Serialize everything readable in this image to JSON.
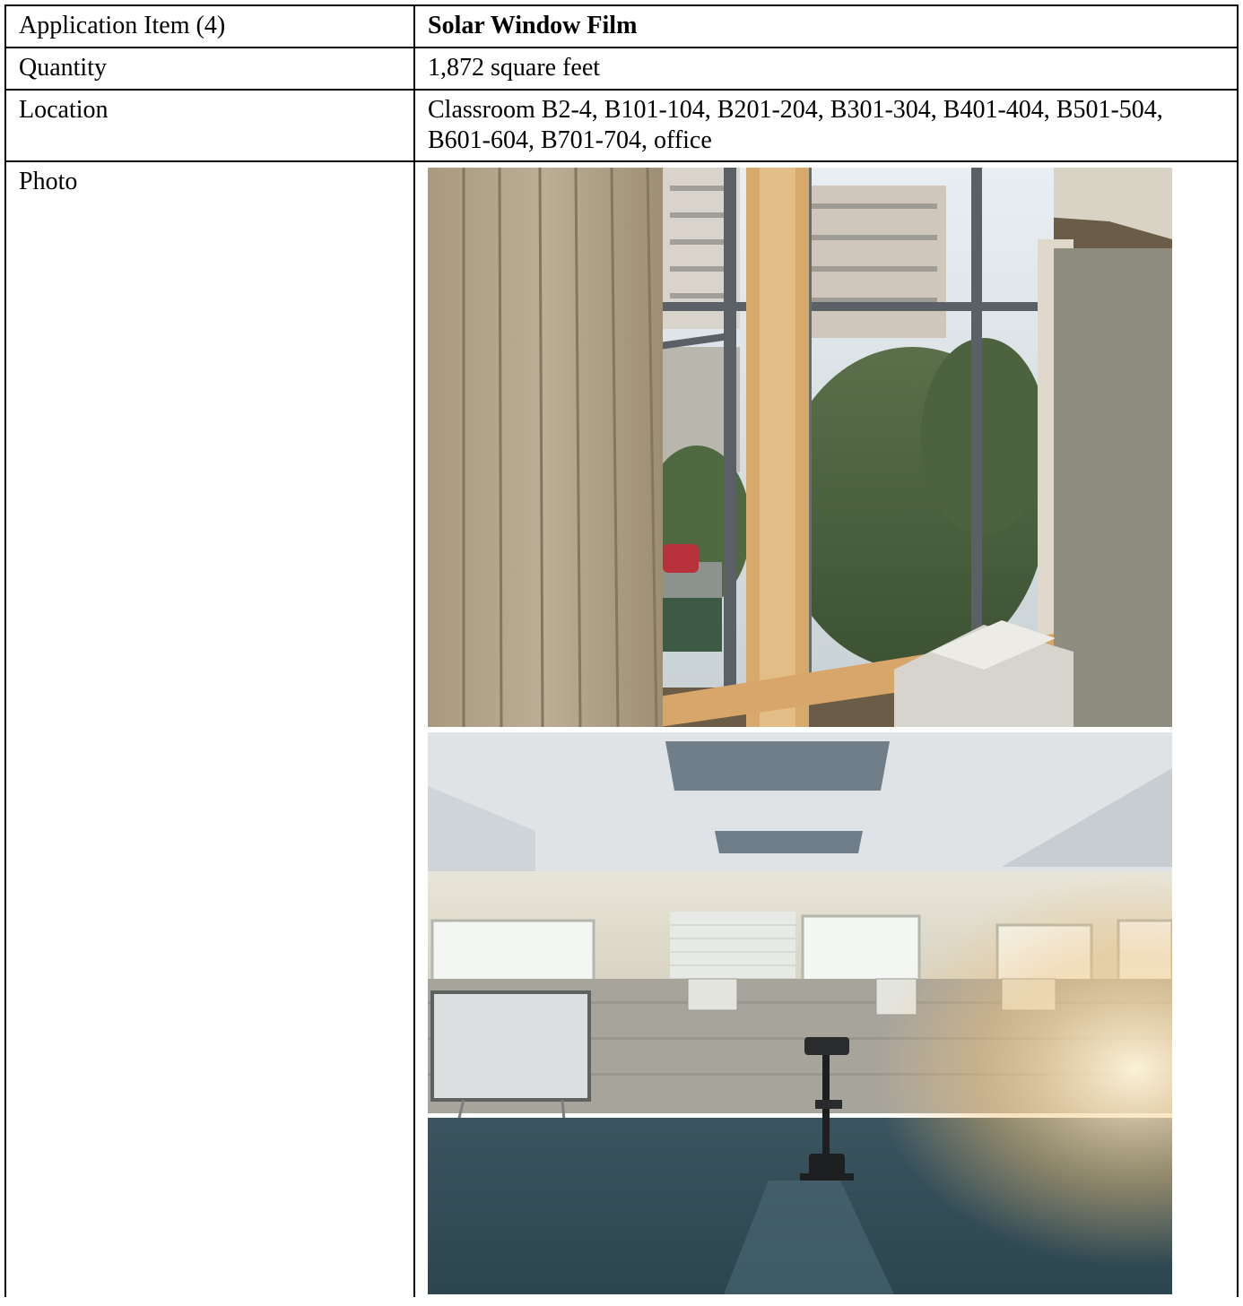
{
  "rows": [
    {
      "label": "Application Item (4)",
      "value": "Solar Window Film",
      "value_bold": true
    },
    {
      "label": "Quantity",
      "value": "1,872 square feet"
    },
    {
      "label": "Location",
      "value": "Classroom B2-4, B101-104, B201-204, B301-304, B401-404, B501-504, B601-604, B701-704, office"
    },
    {
      "label": "Photo"
    }
  ],
  "photos": [
    {
      "name": "classroom-window-with-vertical-blinds"
    },
    {
      "name": "activity-room-with-exercise-bike"
    }
  ]
}
